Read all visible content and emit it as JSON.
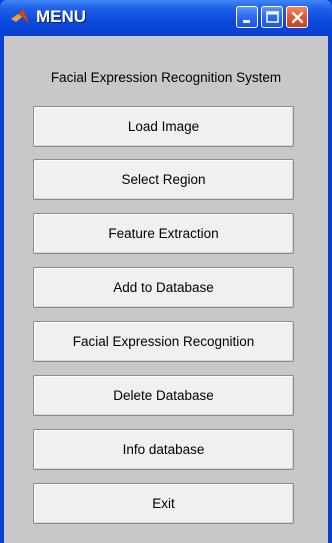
{
  "window": {
    "title": "MENU",
    "icon": "matlab-logo-icon",
    "controls": [
      "minimize-icon",
      "maximize-icon",
      "close-icon"
    ]
  },
  "panel": {
    "heading": "Facial Expression Recognition System"
  },
  "buttons": [
    {
      "label": "Load Image"
    },
    {
      "label": "Select Region"
    },
    {
      "label": "Feature Extraction"
    },
    {
      "label": "Add to Database"
    },
    {
      "label": "Facial Expression Recognition"
    },
    {
      "label": "Delete Database"
    },
    {
      "label": "Info database"
    },
    {
      "label": "Exit"
    }
  ],
  "colors": {
    "titlebar": "#0a3fd1",
    "close_button": "#e35a2f",
    "panel_background": "#c8c8c8",
    "button_face": "#f0f0f0"
  }
}
